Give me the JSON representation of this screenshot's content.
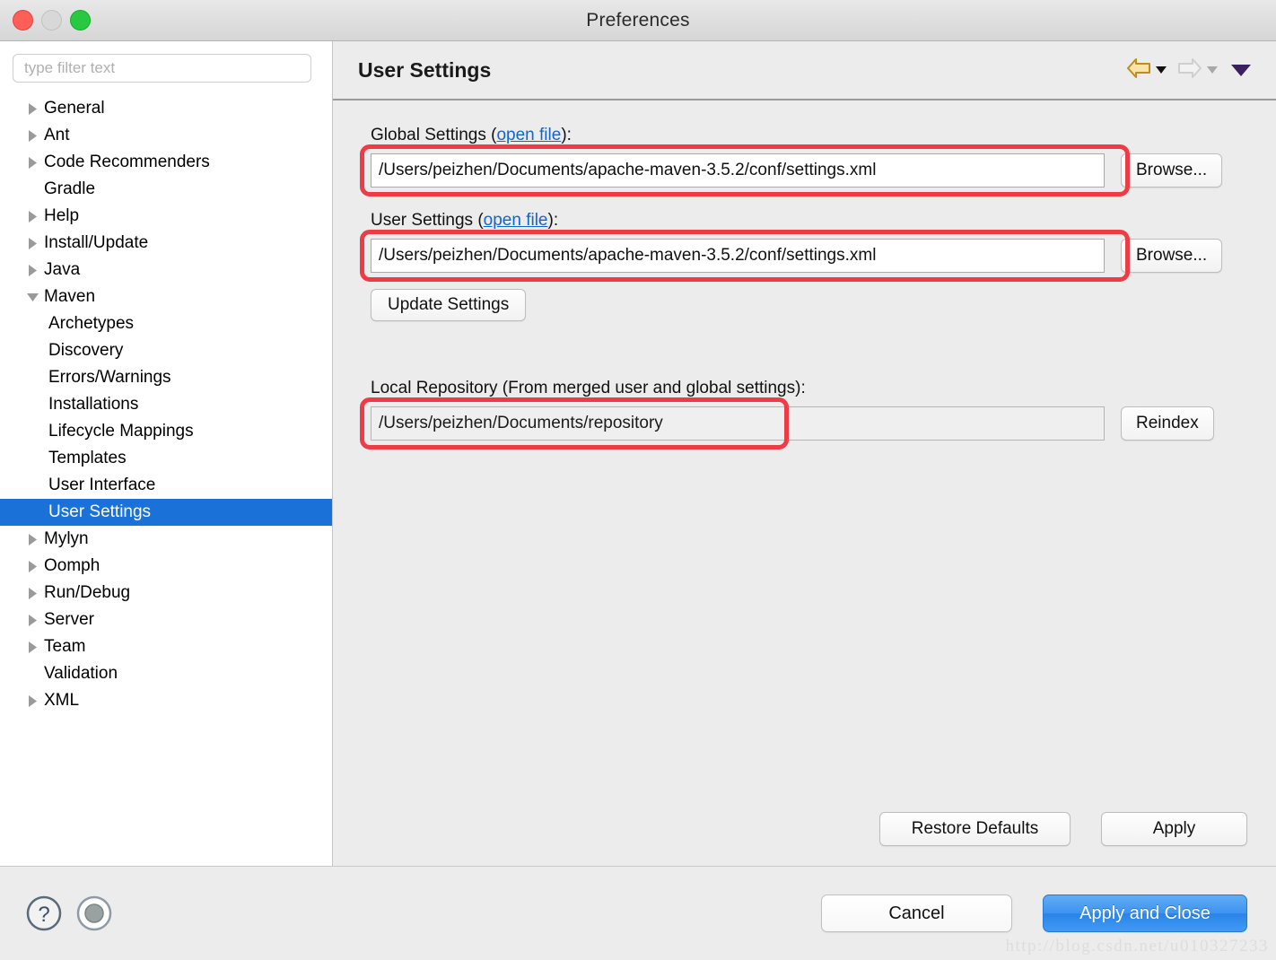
{
  "window": {
    "title": "Preferences",
    "traffic_lights": [
      "close-button",
      "minimize-button",
      "zoom-button"
    ]
  },
  "sidebar": {
    "filter_placeholder": "type filter text",
    "filter_value": "",
    "items": [
      {
        "label": "General",
        "level": 0,
        "twisty": "collapsed",
        "selected": false
      },
      {
        "label": "Ant",
        "level": 0,
        "twisty": "collapsed",
        "selected": false
      },
      {
        "label": "Code Recommenders",
        "level": 0,
        "twisty": "collapsed",
        "selected": false
      },
      {
        "label": "Gradle",
        "level": 0,
        "twisty": "none",
        "selected": false
      },
      {
        "label": "Help",
        "level": 0,
        "twisty": "collapsed",
        "selected": false
      },
      {
        "label": "Install/Update",
        "level": 0,
        "twisty": "collapsed",
        "selected": false
      },
      {
        "label": "Java",
        "level": 0,
        "twisty": "collapsed",
        "selected": false
      },
      {
        "label": "Maven",
        "level": 0,
        "twisty": "expanded",
        "selected": false
      },
      {
        "label": "Archetypes",
        "level": 1,
        "twisty": "none",
        "selected": false
      },
      {
        "label": "Discovery",
        "level": 1,
        "twisty": "none",
        "selected": false
      },
      {
        "label": "Errors/Warnings",
        "level": 1,
        "twisty": "none",
        "selected": false
      },
      {
        "label": "Installations",
        "level": 1,
        "twisty": "none",
        "selected": false
      },
      {
        "label": "Lifecycle Mappings",
        "level": 1,
        "twisty": "none",
        "selected": false
      },
      {
        "label": "Templates",
        "level": 1,
        "twisty": "none",
        "selected": false
      },
      {
        "label": "User Interface",
        "level": 1,
        "twisty": "none",
        "selected": false
      },
      {
        "label": "User Settings",
        "level": 1,
        "twisty": "none",
        "selected": true
      },
      {
        "label": "Mylyn",
        "level": 0,
        "twisty": "collapsed",
        "selected": false
      },
      {
        "label": "Oomph",
        "level": 0,
        "twisty": "collapsed",
        "selected": false
      },
      {
        "label": "Run/Debug",
        "level": 0,
        "twisty": "collapsed",
        "selected": false
      },
      {
        "label": "Server",
        "level": 0,
        "twisty": "collapsed",
        "selected": false
      },
      {
        "label": "Team",
        "level": 0,
        "twisty": "collapsed",
        "selected": false
      },
      {
        "label": "Validation",
        "level": 0,
        "twisty": "none",
        "selected": false
      },
      {
        "label": "XML",
        "level": 0,
        "twisty": "collapsed",
        "selected": false
      }
    ]
  },
  "main": {
    "title": "User Settings",
    "nav": {
      "back_icon": "back-arrow-icon",
      "back_dropdown_icon": "chevron-down-icon",
      "forward_icon": "forward-arrow-icon",
      "forward_dropdown_icon": "chevron-down-icon",
      "menu_icon": "view-menu-chevron-icon"
    },
    "global_settings": {
      "label_prefix": "Global Settings (",
      "link": "open file",
      "label_suffix": "):",
      "value": "/Users/peizhen/Documents/apache-maven-3.5.2/conf/settings.xml",
      "browse_label": "Browse...",
      "highlighted": true
    },
    "user_settings": {
      "label_prefix": "User Settings (",
      "link": "open file",
      "label_suffix": "):",
      "value": "/Users/peizhen/Documents/apache-maven-3.5.2/conf/settings.xml",
      "browse_label": "Browse...",
      "highlighted": true
    },
    "update_settings_label": "Update Settings",
    "local_repository": {
      "label": "Local Repository (From merged user and global settings):",
      "value": "/Users/peizhen/Documents/repository",
      "reindex_label": "Reindex",
      "highlighted": true,
      "read_only": true
    },
    "restore_defaults_label": "Restore Defaults",
    "apply_label": "Apply"
  },
  "footer": {
    "help_icon": "question-mark-help-icon",
    "secondary_icon": "oomph-record-icon",
    "cancel_label": "Cancel",
    "apply_and_close_label": "Apply and Close",
    "watermark": "http://blog.csdn.net/u010327233"
  },
  "colors": {
    "selection_blue": "#1a72d8",
    "primary_button_blue": "#3d93f0",
    "annotation_red": "#ef3b45",
    "link_blue": "#1166cc",
    "window_chrome": "#ececec"
  }
}
